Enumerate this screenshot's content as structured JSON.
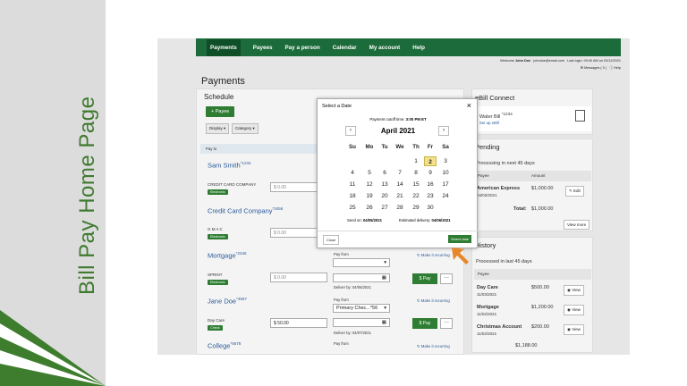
{
  "slide": {
    "title": "Bill Pay Home Page"
  },
  "nav": {
    "items": [
      "Payments",
      "Payees",
      "Pay a person",
      "Calendar",
      "My account",
      "Help"
    ]
  },
  "topbar": {
    "welcome_prefix": "Welcome",
    "user": "John Doe",
    "email": "johndoe@email.com",
    "last_login": "Last login: 09:40 AM on 03/12/2021",
    "messages": "Messages ( 0 )",
    "help": "Help"
  },
  "page": {
    "title": "Payments"
  },
  "schedule": {
    "title": "Schedule",
    "add_payee": "Payee",
    "display": "Display",
    "category": "Category",
    "col_payto": "Pay to",
    "payees": [
      {
        "name": "Sam Smith",
        "acct": "*1234",
        "desc": "CREDIT CARD COMPANY",
        "tag": "Electronic",
        "amount": "0.00"
      },
      {
        "name": "Credit Card Company",
        "acct": "*3456",
        "desc": "G M A C",
        "tag": "Electronic",
        "amount": "0.00"
      },
      {
        "name": "Mortgage",
        "acct": "*2345",
        "desc": "SPRINT",
        "tag": "Electronic",
        "amount": "0.00",
        "pay_from_label": "Pay from",
        "pay_from": "",
        "deliver": "Deliver by: 04/05/2021",
        "recurring": "Make it recurring",
        "pay": "Pay"
      },
      {
        "name": "Jane Doe",
        "acct": "*4567",
        "desc": "Day Care",
        "tag": "Check",
        "amount": "50.00",
        "pay_from_label": "Pay from",
        "pay_from": "Primary Chec...*56",
        "deliver": "Deliver by: 04/07/2021",
        "recurring": "Make it recurring",
        "pay": "Pay"
      },
      {
        "name": "College",
        "acct": "*5678",
        "pay_from_label": "Pay from",
        "recurring": "Make it recurring"
      }
    ]
  },
  "ebill": {
    "title": "eBill Connect",
    "item": "Water Bill",
    "acct": "*1234",
    "setup": "Set up eBill"
  },
  "pending": {
    "title": "Pending",
    "subtitle": "Processing in next 45 days",
    "col_payee": "Payee",
    "col_amount": "Amount",
    "rows": [
      {
        "payee": "American Express",
        "date": "04/03/2021",
        "amount": "$1,000.00",
        "action": "Edit"
      }
    ],
    "total_label": "Total:",
    "total": "$1,000.00",
    "view_more": "View more"
  },
  "history": {
    "title": "History",
    "subtitle": "Processed in last 45 days",
    "col_payee": "Payee",
    "rows": [
      {
        "payee": "Day Care",
        "date": "11/03/2021",
        "amount": "$500.00",
        "action": "View"
      },
      {
        "payee": "Mortgage",
        "date": "11/02/2021",
        "amount": "$1,200.00",
        "action": "View"
      },
      {
        "payee": "Christmas Account",
        "date": "11/02/2021",
        "amount": "$200.00",
        "action": "View"
      }
    ],
    "total": "$1,188.00"
  },
  "modal": {
    "title": "Select a Date",
    "cutoff_prefix": "Payment cutoff time:",
    "cutoff": "3:00 PM ET",
    "month": "April 2021",
    "days": [
      "Su",
      "Mo",
      "Tu",
      "We",
      "Th",
      "Fr",
      "Sa"
    ],
    "weeks": [
      [
        "",
        "",
        "",
        "",
        "1",
        "2",
        "3"
      ],
      [
        "4",
        "5",
        "6",
        "7",
        "8",
        "9",
        "10"
      ],
      [
        "11",
        "12",
        "13",
        "14",
        "15",
        "16",
        "17"
      ],
      [
        "18",
        "19",
        "20",
        "21",
        "22",
        "23",
        "24"
      ],
      [
        "25",
        "26",
        "27",
        "28",
        "29",
        "30",
        ""
      ]
    ],
    "selected": "2",
    "send_on_prefix": "Send on:",
    "send_on": "04/05/2021",
    "est_prefix": "Estimated delivery:",
    "est": "04/06/2021",
    "close": "Close",
    "select": "Select date"
  }
}
